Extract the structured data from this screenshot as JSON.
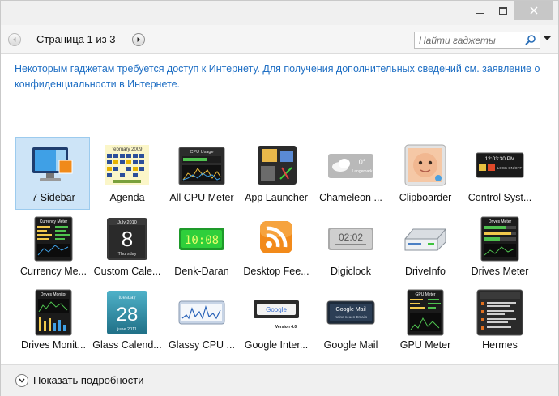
{
  "toolbar": {
    "page_label": "Страница 1 из 3",
    "search_placeholder": "Найти гаджеты"
  },
  "notice": {
    "text": "Некоторым гаджетам требуется доступ к Интернету. Для получения дополнительных сведений см. заявление о конфиденциальности в Интернете."
  },
  "gadgets": [
    {
      "label": "7 Sidebar",
      "icon": "sidebar-monitor-icon",
      "selected": true
    },
    {
      "label": "Agenda",
      "icon": "calendar-grid-icon"
    },
    {
      "label": "All CPU Meter",
      "icon": "cpu-meter-icon"
    },
    {
      "label": "App Launcher",
      "icon": "app-launcher-icon"
    },
    {
      "label": "Chameleon ...",
      "icon": "weather-cloud-icon"
    },
    {
      "label": "Clipboarder",
      "icon": "baby-photo-icon"
    },
    {
      "label": "Control Syst...",
      "icon": "clock-control-icon"
    },
    {
      "label": "Currency Me...",
      "icon": "currency-meter-icon"
    },
    {
      "label": "Custom Cale...",
      "icon": "calendar-page-icon"
    },
    {
      "label": "Denk-Daran",
      "icon": "green-clock-icon"
    },
    {
      "label": "Desktop Fee...",
      "icon": "rss-feed-icon"
    },
    {
      "label": "Digiclock",
      "icon": "digital-clock-icon"
    },
    {
      "label": "DriveInfo",
      "icon": "hard-drive-icon"
    },
    {
      "label": "Drives Meter",
      "icon": "drives-meter-icon"
    },
    {
      "label": "Drives Monit...",
      "icon": "drives-monitor-icon"
    },
    {
      "label": "Glass Calend...",
      "icon": "glass-calendar-icon"
    },
    {
      "label": "Glassy CPU ...",
      "icon": "cpu-graph-icon"
    },
    {
      "label": "Google Inter...",
      "icon": "google-search-icon"
    },
    {
      "label": "Google Mail",
      "icon": "google-mail-icon"
    },
    {
      "label": "GPU Meter",
      "icon": "gpu-meter-icon"
    },
    {
      "label": "Hermes",
      "icon": "hermes-feed-icon"
    }
  ],
  "thumb_text": {
    "agenda_header": "february 2009",
    "cpu_title": "CPU Usage",
    "chameleon_temp": "0°",
    "chameleon_city": "Langemark",
    "control_time": "12:03:30 PM",
    "control_status": "LOCK ON/OFF",
    "currency_title": "Currency Meter",
    "calendar_month": "July 2010",
    "calendar_day": "8",
    "calendar_weekday": "Thursday",
    "denk_time": "10:08",
    "digiclock_time": "02:02",
    "drives_meter_title": "Drives Meter",
    "drives_monitor_title": "Drives Monitor",
    "glass_weekday": "tuesday",
    "glass_day": "28",
    "glass_month": "june 2011",
    "google_brand": "Google",
    "google_version": "Version 4.0",
    "gmail_title": "Google Mail",
    "gmail_sub": "Keine neuen Emails",
    "gpu_title": "GPU Meter"
  },
  "footer": {
    "details_label": "Показать подробности"
  },
  "colors": {
    "notice_link": "#1f6fc4",
    "selection": "#cde4f7",
    "close_button": "#c7c7c7"
  }
}
